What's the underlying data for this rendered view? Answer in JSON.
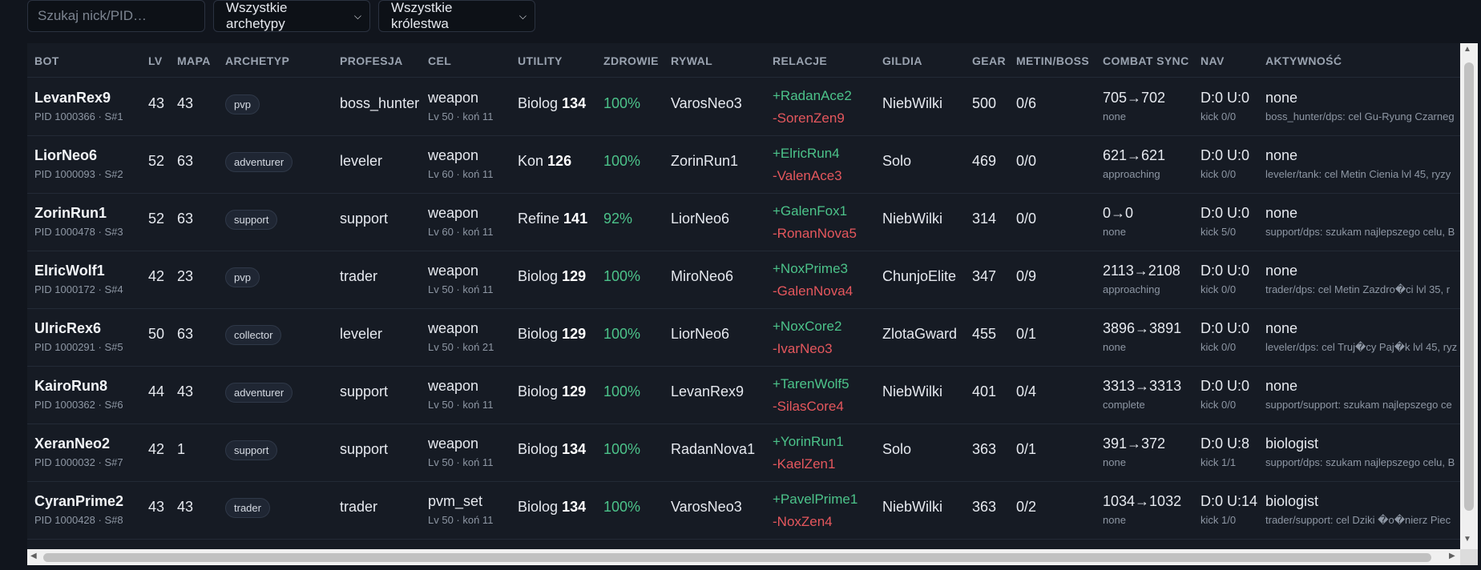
{
  "filters": {
    "search_placeholder": "Szukaj nick/PID…",
    "archetype_select": "Wszystkie archetypy",
    "kingdom_select": "Wszystkie królestwa"
  },
  "columns": [
    "BOT",
    "LV",
    "MAPA",
    "ARCHETYP",
    "PROFESJA",
    "CEL",
    "UTILITY",
    "ZDROWIE",
    "RYWAL",
    "RELACJE",
    "GILDIA",
    "GEAR",
    "METIN/BOSS",
    "COMBAT SYNC",
    "NAV",
    "AKTYWNOŚĆ"
  ],
  "rows": [
    {
      "name": "LevanRex9",
      "pid": "PID 1000366 · S#1",
      "lv": "43",
      "mapa": "43",
      "archetyp": "pvp",
      "profesja": "boss_hunter",
      "cel": "weapon",
      "cel_sub": "Lv 50 · koń 11",
      "utility_label": "Biolog",
      "utility_value": "134",
      "zdrowie": "100%",
      "rywal": "VarosNeo3",
      "rel_plus": "+RadanAce2",
      "rel_minus": "-SorenZen9",
      "gildia": "NiebWilki",
      "gear": "500",
      "metin": "0/6",
      "combat": "705→702",
      "combat_sub": "none",
      "nav": "D:0 U:0",
      "nav_sub": "kick 0/0",
      "akt": "none",
      "akt_sub": "boss_hunter/dps: cel Gu-Ryung Czarneg"
    },
    {
      "name": "LiorNeo6",
      "pid": "PID 1000093 · S#2",
      "lv": "52",
      "mapa": "63",
      "archetyp": "adventurer",
      "profesja": "leveler",
      "cel": "weapon",
      "cel_sub": "Lv 60 · koń 11",
      "utility_label": "Kon",
      "utility_value": "126",
      "zdrowie": "100%",
      "rywal": "ZorinRun1",
      "rel_plus": "+ElricRun4",
      "rel_minus": "-ValenAce3",
      "gildia": "Solo",
      "gear": "469",
      "metin": "0/0",
      "combat": "621→621",
      "combat_sub": "approaching",
      "nav": "D:0 U:0",
      "nav_sub": "kick 0/0",
      "akt": "none",
      "akt_sub": "leveler/tank: cel Metin Cienia lvl 45, ryzy"
    },
    {
      "name": "ZorinRun1",
      "pid": "PID 1000478 · S#3",
      "lv": "52",
      "mapa": "63",
      "archetyp": "support",
      "profesja": "support",
      "cel": "weapon",
      "cel_sub": "Lv 60 · koń 11",
      "utility_label": "Refine",
      "utility_value": "141",
      "zdrowie": "92%",
      "rywal": "LiorNeo6",
      "rel_plus": "+GalenFox1",
      "rel_minus": "-RonanNova5",
      "gildia": "NiebWilki",
      "gear": "314",
      "metin": "0/0",
      "combat": "0→0",
      "combat_sub": "none",
      "nav": "D:0 U:0",
      "nav_sub": "kick 5/0",
      "akt": "none",
      "akt_sub": "support/dps: szukam najlepszego celu, B"
    },
    {
      "name": "ElricWolf1",
      "pid": "PID 1000172 · S#4",
      "lv": "42",
      "mapa": "23",
      "archetyp": "pvp",
      "profesja": "trader",
      "cel": "weapon",
      "cel_sub": "Lv 50 · koń 11",
      "utility_label": "Biolog",
      "utility_value": "129",
      "zdrowie": "100%",
      "rywal": "MiroNeo6",
      "rel_plus": "+NoxPrime3",
      "rel_minus": "-GalenNova4",
      "gildia": "ChunjoElite",
      "gear": "347",
      "metin": "0/9",
      "combat": "2113→2108",
      "combat_sub": "approaching",
      "nav": "D:0 U:0",
      "nav_sub": "kick 0/0",
      "akt": "none",
      "akt_sub": "trader/dps: cel Metin Zazdro�ci lvl 35, r"
    },
    {
      "name": "UlricRex6",
      "pid": "PID 1000291 · S#5",
      "lv": "50",
      "mapa": "63",
      "archetyp": "collector",
      "profesja": "leveler",
      "cel": "weapon",
      "cel_sub": "Lv 50 · koń 21",
      "utility_label": "Biolog",
      "utility_value": "129",
      "zdrowie": "100%",
      "rywal": "LiorNeo6",
      "rel_plus": "+NoxCore2",
      "rel_minus": "-IvarNeo3",
      "gildia": "ZlotaGward",
      "gear": "455",
      "metin": "0/1",
      "combat": "3896→3891",
      "combat_sub": "none",
      "nav": "D:0 U:0",
      "nav_sub": "kick 0/0",
      "akt": "none",
      "akt_sub": "leveler/dps: cel Truj�cy Paj�k lvl 45, ryz"
    },
    {
      "name": "KairoRun8",
      "pid": "PID 1000362 · S#6",
      "lv": "44",
      "mapa": "43",
      "archetyp": "adventurer",
      "profesja": "support",
      "cel": "weapon",
      "cel_sub": "Lv 50 · koń 11",
      "utility_label": "Biolog",
      "utility_value": "129",
      "zdrowie": "100%",
      "rywal": "LevanRex9",
      "rel_plus": "+TarenWolf5",
      "rel_minus": "-SilasCore4",
      "gildia": "NiebWilki",
      "gear": "401",
      "metin": "0/4",
      "combat": "3313→3313",
      "combat_sub": "complete",
      "nav": "D:0 U:0",
      "nav_sub": "kick 0/0",
      "akt": "none",
      "akt_sub": "support/support: szukam najlepszego ce"
    },
    {
      "name": "XeranNeo2",
      "pid": "PID 1000032 · S#7",
      "lv": "42",
      "mapa": "1",
      "archetyp": "support",
      "profesja": "support",
      "cel": "weapon",
      "cel_sub": "Lv 50 · koń 11",
      "utility_label": "Biolog",
      "utility_value": "134",
      "zdrowie": "100%",
      "rywal": "RadanNova1",
      "rel_plus": "+YorinRun1",
      "rel_minus": "-KaelZen1",
      "gildia": "Solo",
      "gear": "363",
      "metin": "0/1",
      "combat": "391→372",
      "combat_sub": "none",
      "nav": "D:0 U:8",
      "nav_sub": "kick 1/1",
      "akt": "biologist",
      "akt_sub": "support/dps: szukam najlepszego celu, B"
    },
    {
      "name": "CyranPrime2",
      "pid": "PID 1000428 · S#8",
      "lv": "43",
      "mapa": "43",
      "archetyp": "trader",
      "profesja": "trader",
      "cel": "pvm_set",
      "cel_sub": "Lv 50 · koń 11",
      "utility_label": "Biolog",
      "utility_value": "134",
      "zdrowie": "100%",
      "rywal": "VarosNeo3",
      "rel_plus": "+PavelPrime1",
      "rel_minus": "-NoxZen4",
      "gildia": "NiebWilki",
      "gear": "363",
      "metin": "0/2",
      "combat": "1034→1032",
      "combat_sub": "none",
      "nav": "D:0 U:14",
      "nav_sub": "kick 1/0",
      "akt": "biologist",
      "akt_sub": "trader/support: cel Dziki �o�nierz Piec"
    }
  ]
}
